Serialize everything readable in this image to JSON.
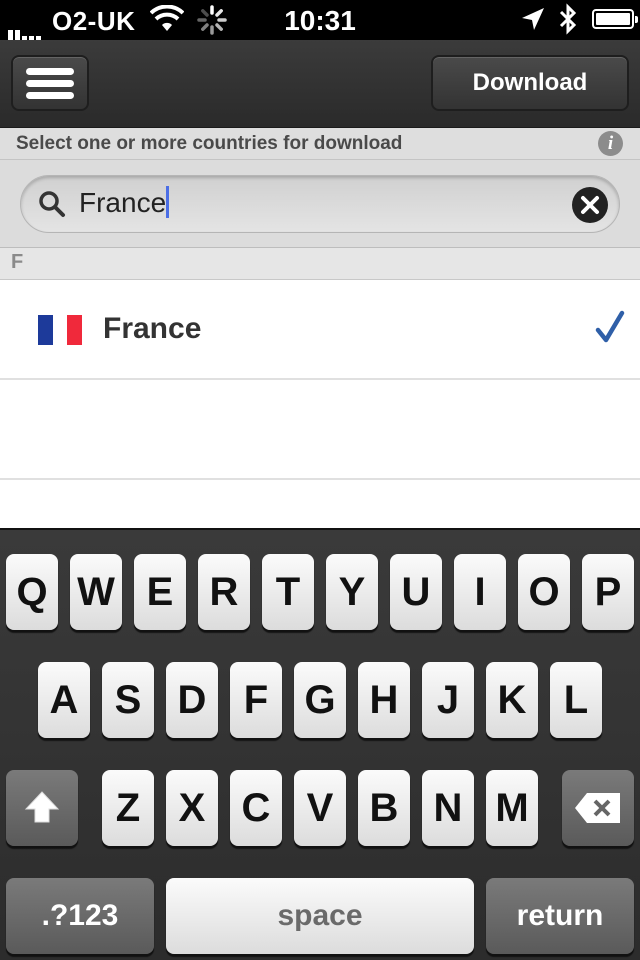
{
  "status_bar": {
    "carrier": "O2-UK",
    "time": "10:31"
  },
  "nav": {
    "download_label": "Download"
  },
  "subheader": {
    "text": "Select one or more countries for download"
  },
  "search": {
    "query": "France"
  },
  "section": {
    "letter": "F"
  },
  "countries": [
    {
      "name": "France",
      "selected": true,
      "flag_colors": [
        "#002395",
        "#ffffff",
        "#ed2939"
      ]
    }
  ],
  "colors": {
    "accent": "#2f5fa8",
    "caret": "#4b6ee5"
  },
  "keyboard": {
    "row1": [
      "Q",
      "W",
      "E",
      "R",
      "T",
      "Y",
      "U",
      "I",
      "O",
      "P"
    ],
    "row2": [
      "A",
      "S",
      "D",
      "F",
      "G",
      "H",
      "J",
      "K",
      "L"
    ],
    "row3": [
      "Z",
      "X",
      "C",
      "V",
      "B",
      "N",
      "M"
    ],
    "numbers_label": ".?123",
    "space_label": "space",
    "return_label": "return"
  }
}
